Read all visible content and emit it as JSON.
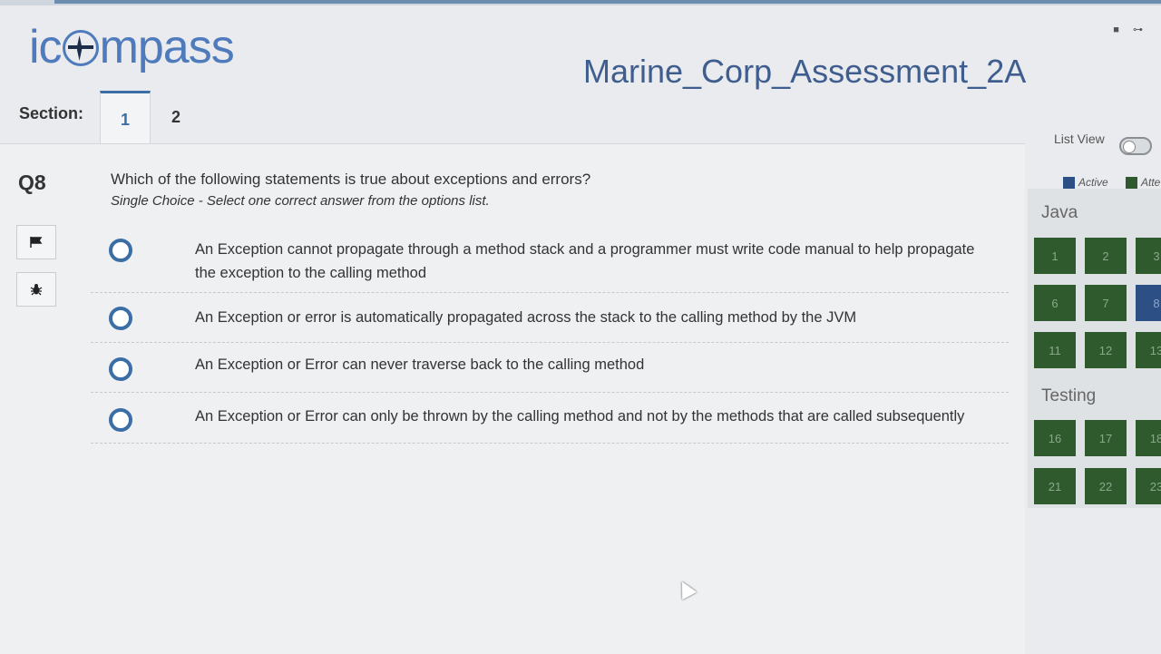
{
  "app": {
    "logo_text": "icompass",
    "assessment_title": "Marine_Corp_Assessment_2A"
  },
  "sections": {
    "label": "Section:",
    "tabs": [
      {
        "label": "1",
        "active": true
      },
      {
        "label": "2",
        "active": false
      }
    ]
  },
  "question": {
    "number": "Q8",
    "text": "Which of the following statements is true about exceptions and errors?",
    "subtitle": "Single Choice - Select one correct answer from the options list.",
    "options": [
      {
        "text": "An Exception cannot propagate through a method stack and a programmer must write code manual to help propagate the exception to the calling method",
        "selected": false
      },
      {
        "text": "An Exception or error is automatically propagated across the stack to the calling method by the JVM",
        "selected": false
      },
      {
        "text": "An Exception or Error can never traverse back to the calling method",
        "selected": false
      },
      {
        "text": "An Exception or Error can only be thrown by the calling method and not by the methods that are called subsequently",
        "selected": false
      }
    ]
  },
  "side_buttons": [
    {
      "icon": "flag-icon"
    },
    {
      "icon": "bug-icon"
    }
  ],
  "panel": {
    "list_view_label": "List View",
    "list_view_on": false,
    "legend": [
      {
        "label": "Active",
        "color": "#2c4f86"
      },
      {
        "label": "Atte",
        "color": "#2f5a2e"
      }
    ],
    "groups": [
      {
        "name": "Java",
        "questions": [
          "1",
          "2",
          "3",
          "6",
          "7",
          "8",
          "11",
          "12",
          "13"
        ],
        "active": "8"
      },
      {
        "name": "Testing",
        "questions": [
          "16",
          "17",
          "18",
          "21",
          "22",
          "23"
        ],
        "active": ""
      }
    ]
  },
  "colors": {
    "accent": "#3a6ea5",
    "question_box": "#2f5a2e",
    "question_box_active": "#2c4f86"
  }
}
